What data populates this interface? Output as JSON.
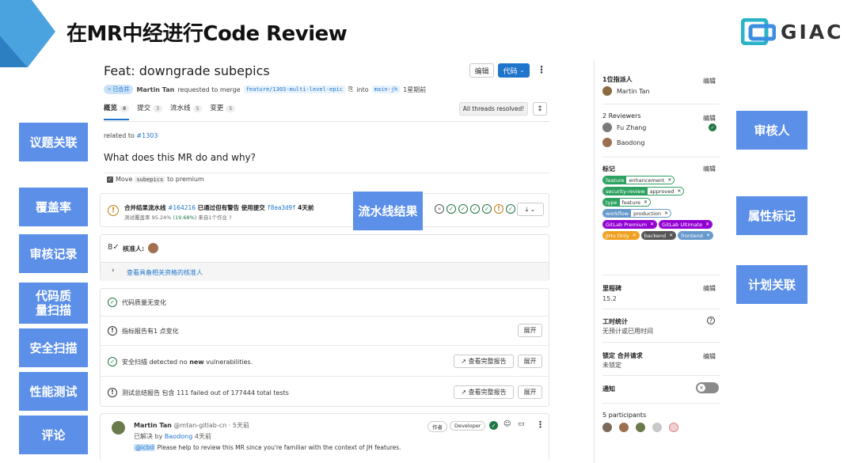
{
  "slide": {
    "title": "在MR中经进行Code Review",
    "logo_text": "GIAC"
  },
  "side_tags": {
    "left": [
      "议题关联",
      "覆盖率",
      "审核记录",
      "代码质量扫描",
      "安全扫描",
      "性能测试",
      "评论"
    ],
    "mid": "流水线结果",
    "right": [
      "审核人",
      "属性标记",
      "计划关联"
    ]
  },
  "mr": {
    "title": "Feat: downgrade subepics",
    "status": "已合并",
    "author": "Martin Tan",
    "requested": "requested to merge",
    "source_branch": "feature/1303-multi-level-epic",
    "into": "into",
    "target_branch": "main-jh",
    "time": "1星期前",
    "edit_label": "编辑",
    "code_label": "代码",
    "tabs": [
      {
        "label": "概览",
        "count": "8"
      },
      {
        "label": "提交",
        "count": "3"
      },
      {
        "label": "流水线",
        "count": "5"
      },
      {
        "label": "变更",
        "count": "5"
      }
    ],
    "threads": "All threads resolved!",
    "related": "related to",
    "related_issue": "#1303",
    "heading": "What does this MR do and why?",
    "checklist_pre": "Move",
    "checklist_code": "subepics",
    "checklist_post": "to premium"
  },
  "pipeline": {
    "line1_pre": "合并结果流水线",
    "pipeline_id": "#164216",
    "line1_mid": "已通过但有警告 使用提交",
    "commit": "f8ea3d9f",
    "line1_time": "4天前",
    "line2_pre": "测试覆盖率",
    "coverage": "95.24%",
    "coverage_delta": "(19.68%)",
    "line2_post": "来自1个作业"
  },
  "approval": {
    "label": "核准人:",
    "link": "查看具备相关资格的核准人"
  },
  "checks": [
    {
      "text": "代码质量无变化",
      "status": "ok",
      "report": "",
      "expand": ""
    },
    {
      "text": "指标报告有1 点变化",
      "status": "warn",
      "report": "",
      "expand": "展开"
    },
    {
      "text_pre": "安全扫描 detected no ",
      "text_bold": "new",
      "text_post": " vulnerabilities.",
      "status": "ok",
      "report": "查看完整报告",
      "expand": "展开"
    },
    {
      "text": "测试总结报告 包含 111 failed out of 177444 total tests",
      "status": "warn",
      "report": "查看完整报告",
      "expand": "展开"
    }
  ],
  "comment": {
    "author": "Martin Tan",
    "handle": "@mtan-gitlab-cn",
    "time": "· 5天前",
    "resolved_pre": "已解决 by",
    "resolved_by": "Baodong",
    "resolved_time": "4天前",
    "mention": "@icbd",
    "body": "Please help to review this MR since you're familiar with the context of JH features.",
    "badge_author": "作者",
    "badge_role": "Developer"
  },
  "sidebar": {
    "assignee_title": "1位指派人",
    "assignee": "Martin Tan",
    "reviewers_title": "2 Reviewers",
    "reviewers": [
      "Fu Zhang",
      "Baodong"
    ],
    "labels_title": "标记",
    "edit": "编辑",
    "labels": [
      {
        "k": "feature",
        "v": "enhancement",
        "color": "#2da160"
      },
      {
        "k": "security-review",
        "v": "approved",
        "color": "#2da160"
      },
      {
        "k": "type",
        "v": "feature",
        "color": "#2da160"
      },
      {
        "k": "workflow",
        "v": "production",
        "color": "#6699cc"
      },
      {
        "k": "GitLab Premium",
        "v": "",
        "color": "#9400d3"
      },
      {
        "k": "GitLab Ultimate",
        "v": "",
        "color": "#9400d3"
      },
      {
        "k": "JiHu Only",
        "v": "",
        "color": "#f0a020"
      },
      {
        "k": "backend",
        "v": "",
        "color": "#555555"
      },
      {
        "k": "frontend",
        "v": "",
        "color": "#6699cc"
      }
    ],
    "milestone_title": "里程碑",
    "milestone": "15.2",
    "time_title": "工时统计",
    "time_value": "无预计或已用时间",
    "lock_title": "锁定 合并请求",
    "lock_value": "未锁定",
    "notify_title": "通知",
    "participants_title": "5 participants"
  }
}
